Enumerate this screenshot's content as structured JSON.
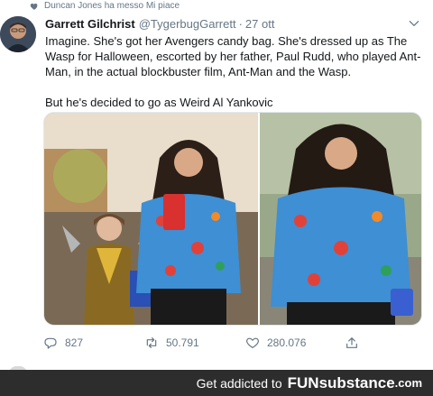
{
  "liked_by": {
    "text": "Duncan Jones ha messo Mi piace"
  },
  "tweet": {
    "author_name": "Garrett Gilchrist",
    "author_handle": "@TygerbugGarrett",
    "separator": "·",
    "date": "27 ott",
    "paragraph_1": "Imagine. She's got her Avengers candy bag. She's dressed up as The Wasp for Halloween, escorted by her father, Paul Rudd, who played Ant-Man, in the actual blockbuster film, Ant-Man and the Wasp.",
    "paragraph_2": "But he's decided to go as Weird Al Yankovic"
  },
  "actions": {
    "replies": "827",
    "retweets": "50.791",
    "likes": "280.076"
  },
  "footer": {
    "text": "Get addicted to",
    "logo_fun": "FUN",
    "logo_rest": "substance",
    "logo_tld": ".com"
  },
  "colors": {
    "muted": "#657786",
    "text": "#14171a",
    "footer_bg": "#2d2d2d"
  },
  "icons": [
    "heart-icon",
    "chevron-down-icon",
    "reply-icon",
    "retweet-icon",
    "like-icon",
    "share-icon"
  ]
}
